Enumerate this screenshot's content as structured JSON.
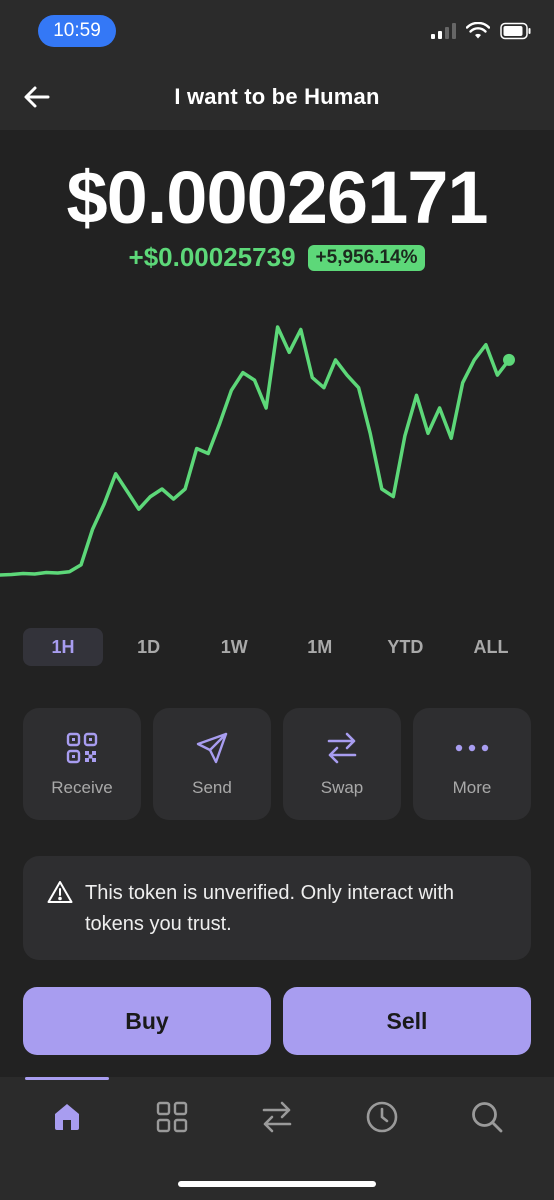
{
  "status_bar": {
    "time": "10:59"
  },
  "header": {
    "title": "I want to be Human"
  },
  "price": {
    "value": "$0.00026171",
    "change_abs": "+$0.00025739",
    "change_pct": "+5,956.14%"
  },
  "colors": {
    "accent": "#a89df0",
    "positive": "#5dd879",
    "background": "#222222"
  },
  "chart_data": {
    "type": "line",
    "x": [
      0,
      1,
      2,
      3,
      4,
      5,
      6,
      7,
      8,
      9,
      10,
      11,
      12,
      13,
      14,
      15,
      16,
      17,
      18,
      19,
      20,
      21,
      22,
      23,
      24,
      25,
      26,
      27,
      28,
      29,
      30,
      31,
      32,
      33,
      34,
      35,
      36,
      37,
      38,
      39,
      40,
      41,
      42,
      43,
      44,
      45,
      46,
      47,
      48,
      49,
      50,
      51,
      52,
      53,
      54,
      55,
      56,
      57,
      58,
      59
    ],
    "y": [
      0,
      0.2,
      0.6,
      0.4,
      1.0,
      0.8,
      1.3,
      4,
      18,
      28,
      40,
      33,
      26,
      31,
      34,
      30,
      34,
      50,
      48,
      60,
      73,
      80,
      77,
      66,
      98,
      88,
      97,
      78,
      74,
      85,
      79,
      74,
      56,
      34,
      31,
      55,
      71,
      56,
      66,
      54,
      76,
      85,
      91,
      79,
      85
    ],
    "series": [
      {
        "values": [
          0,
          0.2,
          0.6,
          0.4,
          1.0,
          0.8,
          1.3,
          4,
          18,
          28,
          40,
          33,
          26,
          31,
          34,
          30,
          34,
          50,
          48,
          60,
          73,
          80,
          77,
          66,
          98,
          88,
          97,
          78,
          74,
          85,
          79,
          74,
          56,
          34,
          31,
          55,
          71,
          56,
          66,
          54,
          76,
          85,
          91,
          79,
          85
        ]
      }
    ],
    "title": "",
    "xlabel": "",
    "ylabel": "",
    "grid": false,
    "legend": "none",
    "color": "#5dd879"
  },
  "ranges": {
    "items": [
      "1H",
      "1D",
      "1W",
      "1M",
      "YTD",
      "ALL"
    ],
    "selected": "1H"
  },
  "actions": [
    {
      "label": "Receive",
      "icon": "qr-code-icon"
    },
    {
      "label": "Send",
      "icon": "send-icon"
    },
    {
      "label": "Swap",
      "icon": "swap-icon"
    },
    {
      "label": "More",
      "icon": "more-icon"
    }
  ],
  "warning": {
    "text": "This token is unverified. Only interact with tokens you trust.",
    "icon": "warning-triangle-icon"
  },
  "trade": {
    "buy_label": "Buy",
    "sell_label": "Sell"
  },
  "tabbar": {
    "tabs": [
      "home-icon",
      "grid-icon",
      "swap-icon",
      "clock-icon",
      "search-icon"
    ],
    "active": "home-icon"
  }
}
